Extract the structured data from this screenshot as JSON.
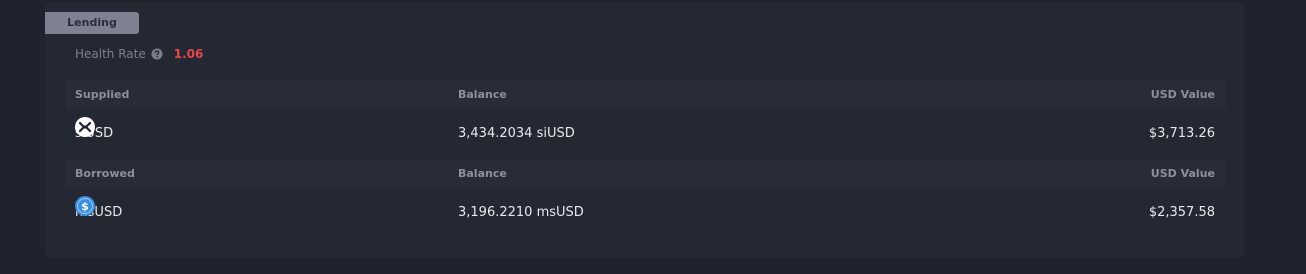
{
  "lending": {
    "tab_label": "Lending",
    "health_rate_label": "Health Rate",
    "health_rate_value": "1.06",
    "health_rate_color": "#e8454a"
  },
  "supplied": {
    "headers": {
      "name": "Supplied",
      "balance": "Balance",
      "usd": "USD Value"
    },
    "rows": [
      {
        "token": "siUSD",
        "icon": "siusd-token-icon",
        "balance": "3,434.2034 siUSD",
        "usd": "$3,713.26"
      }
    ]
  },
  "borrowed": {
    "headers": {
      "name": "Borrowed",
      "balance": "Balance",
      "usd": "USD Value"
    },
    "rows": [
      {
        "token": "msUSD",
        "icon": "msusd-token-icon",
        "balance": "3,196.2210 msUSD",
        "usd": "$2,357.58"
      }
    ]
  }
}
